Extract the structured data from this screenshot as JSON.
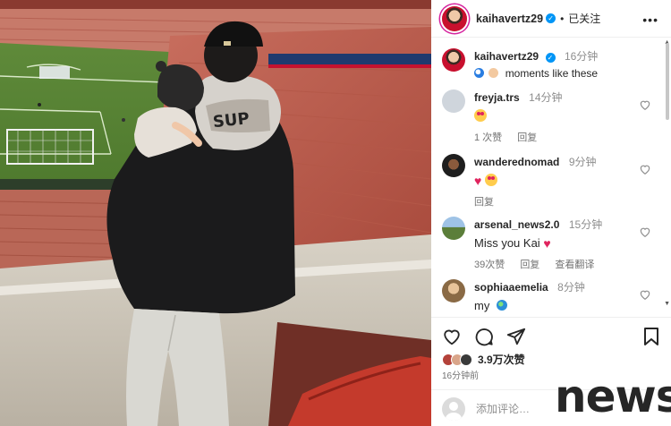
{
  "header": {
    "username": "kaihavertz29",
    "separator": "•",
    "follow_label": "已关注",
    "more_icon": "more-horizontal-icon"
  },
  "caption": {
    "username": "kaihavertz29",
    "time": "16分钟",
    "text": "moments like these",
    "emojis": [
      "soccer-ball-emoji",
      "baby-emoji"
    ]
  },
  "comments": [
    {
      "username": "freyja.trs",
      "time": "14分钟",
      "text": "",
      "emoji": "heart-eyes",
      "likes": "1 次赞",
      "reply": "回复",
      "avatar_color": "#cfd5dc"
    },
    {
      "username": "wanderednomad",
      "time": "9分钟",
      "text": "",
      "emoji": "heart-and-heart-eyes",
      "likes": "",
      "reply": "回复",
      "avatar_color": "#2a2a2a"
    },
    {
      "username": "arsenal_news2.0",
      "time": "15分钟",
      "text": "Miss you Kai",
      "emoji": "heart",
      "likes": "39次赞",
      "reply": "回复",
      "translate": "查看翻译",
      "avatar_color": "#3d6fa8"
    },
    {
      "username": "sophiaaemelia",
      "time": "8分钟",
      "text": "my",
      "emoji": "globe",
      "likes": "",
      "reply": "",
      "avatar_color": "#c9a27a"
    }
  ],
  "actions": {
    "icons": [
      "heart-icon",
      "comment-icon",
      "share-icon",
      "bookmark-icon"
    ],
    "likes_count": "3.9万次赞",
    "post_time": "16分钟前"
  },
  "add_comment": {
    "placeholder": "添加评论…"
  },
  "watermark": "news",
  "colors": {
    "verified": "#0095f6",
    "secondary_text": "#8e8e8e",
    "heart_red": "#e0245e",
    "story_ring": "#d6249f"
  }
}
